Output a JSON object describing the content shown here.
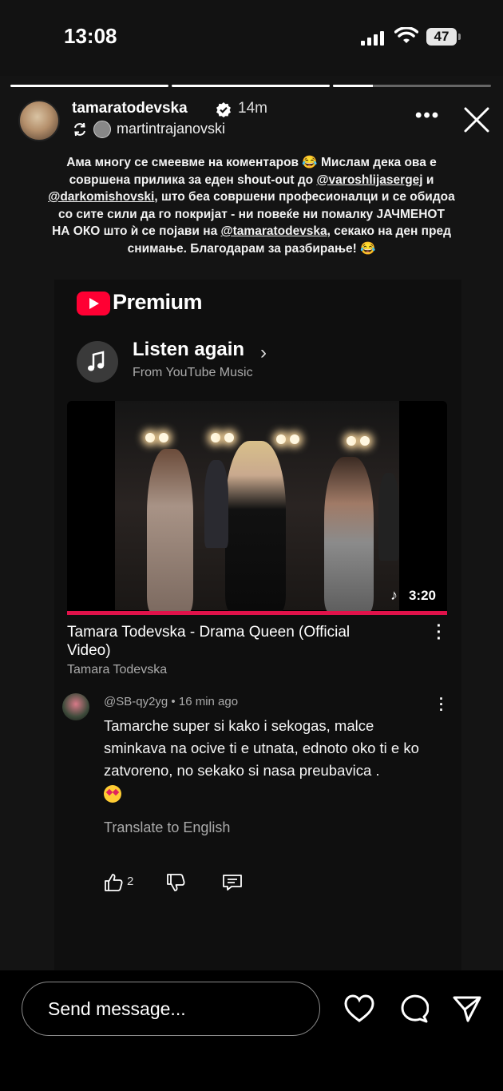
{
  "status_bar": {
    "time": "13:08",
    "battery": "47"
  },
  "story": {
    "progress": [
      1.0,
      1.0,
      0.25
    ],
    "username": "tamaratodevska",
    "time_ago": "14m",
    "collaborator": "martintrajanovski",
    "caption": {
      "p1": "Ама многу се смеевме на коментаров 😂 Мислам дека ова е совршена прилика за еден shout-out до ",
      "m1": "@varoshlijasergej",
      "p2": " и ",
      "m2": "@darkomishovski",
      "p3": ", што беа совршени професионалци и се обидоа со сите сили да го покријат - ни повеќе ни помалку ЈАЧМЕНОТ НА ОКО што ѝ се појави на ",
      "m3": "@tamaratodevska",
      "p4": ", секако на ден пред снимање. Благодарам за разбирање! 😂"
    }
  },
  "card": {
    "brand": "Premium",
    "listen_again": "Listen again",
    "from": "From YouTube Music",
    "video": {
      "duration": "3:20",
      "title": "Tamara Todevska - Drama Queen (Official Video)",
      "channel": "Tamara Todevska",
      "watched_fraction": 1.0
    },
    "comment": {
      "handle": "@SB-qy2yg • 16 min ago",
      "text": "Tamarche super si kako i sekogas, malce sminkava na ocive ti e utnata, ednoto oko ti e ko zatvoreno, no sekako si nasa preubavica .",
      "translate": "Translate to English",
      "likes": "2"
    }
  },
  "bottom_bar": {
    "placeholder": "Send message..."
  },
  "colors": {
    "yt_red": "#ff0033",
    "progress_red": "#e0124a"
  }
}
